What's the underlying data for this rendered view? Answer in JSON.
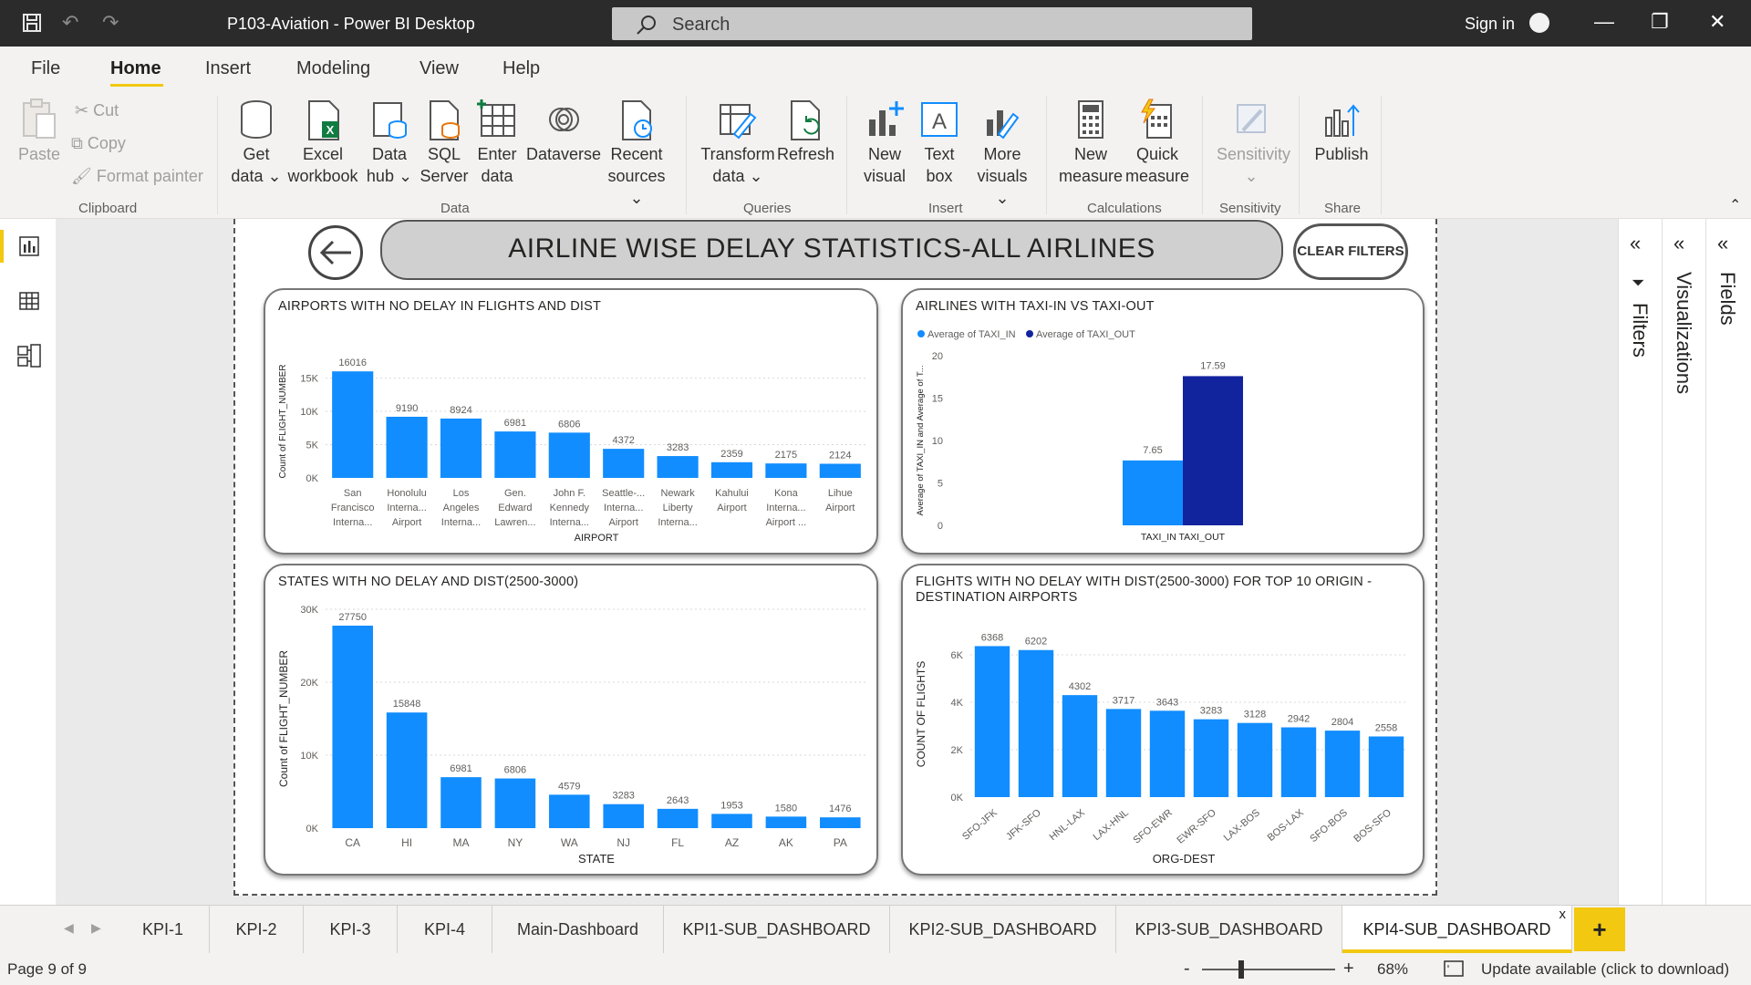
{
  "window": {
    "title": "P103-Aviation - Power BI Desktop",
    "search_placeholder": "Search",
    "signin": "Sign in"
  },
  "menu": [
    "File",
    "Home",
    "Insert",
    "Modeling",
    "View",
    "Help"
  ],
  "ribbon": {
    "clipboard": {
      "paste": "Paste",
      "cut": "Cut",
      "copy": "Copy",
      "format_painter": "Format painter",
      "group": "Clipboard"
    },
    "data": {
      "get_data": [
        "Get",
        "data"
      ],
      "excel": [
        "Excel",
        "workbook"
      ],
      "data_hub": [
        "Data",
        "hub"
      ],
      "sql": [
        "SQL",
        "Server"
      ],
      "enter": [
        "Enter",
        "data"
      ],
      "dataverse": "Dataverse",
      "recent": [
        "Recent",
        "sources"
      ],
      "group": "Data"
    },
    "queries": {
      "transform": [
        "Transform",
        "data"
      ],
      "refresh": "Refresh",
      "group": "Queries"
    },
    "insert": {
      "new_visual": [
        "New",
        "visual"
      ],
      "text_box": [
        "Text",
        "box"
      ],
      "more_visuals": [
        "More",
        "visuals"
      ],
      "group": "Insert"
    },
    "calculations": {
      "new_measure": [
        "New",
        "measure"
      ],
      "quick_measure": [
        "Quick",
        "measure"
      ],
      "group": "Calculations"
    },
    "sensitivity": {
      "label": "Sensitivity",
      "group": "Sensitivity"
    },
    "share": {
      "publish": "Publish",
      "group": "Share"
    }
  },
  "report": {
    "title": "AIRLINE WISE DELAY STATISTICS-ALL AIRLINES",
    "clear_filters": "CLEAR FILTERS"
  },
  "panes": {
    "filters": "Filters",
    "visualizations": "Visualizations",
    "fields": "Fields"
  },
  "tabs": [
    "KPI-1",
    "KPI-2",
    "KPI-3",
    "KPI-4",
    "Main-Dashboard",
    "KPI1-SUB_DASHBOARD",
    "KPI2-SUB_DASHBOARD",
    "KPI3-SUB_DASHBOARD",
    "KPI4-SUB_DASHBOARD"
  ],
  "tab_close": "x",
  "tab_add": "+",
  "status": {
    "page": "Page 9 of 9",
    "zoom_minus": "-",
    "zoom_plus": "+",
    "zoom": "68%",
    "update": "Update available (click to download)"
  },
  "colors": {
    "bar": "#118dff",
    "bar_dark": "#12239e",
    "accent": "#f2c811"
  },
  "chart_data": [
    {
      "type": "bar",
      "title": "AIRPORTS WITH NO DELAY IN FLIGHTS AND DIST",
      "xlabel": "AIRPORT",
      "ylabel": "Count of FLIGHT_NUMBER",
      "ylim": [
        0,
        17000
      ],
      "yticks": [
        "0K",
        "5K",
        "10K",
        "15K"
      ],
      "ytick_values": [
        0,
        5000,
        10000,
        15000
      ],
      "categories": [
        [
          "San",
          "Francisco",
          "Interna..."
        ],
        [
          "Honolulu",
          "Interna...",
          "Airport"
        ],
        [
          "Los",
          "Angeles",
          "Interna..."
        ],
        [
          "Gen.",
          "Edward",
          "Lawren..."
        ],
        [
          "John F.",
          "Kennedy",
          "Interna..."
        ],
        [
          "Seattle-...",
          "Interna...",
          "Airport"
        ],
        [
          "Newark",
          "Liberty",
          "Interna..."
        ],
        [
          "Kahului",
          "Airport"
        ],
        [
          "Kona",
          "Interna...",
          "Airport ..."
        ],
        [
          "Lihue",
          "Airport"
        ]
      ],
      "values": [
        16016,
        9190,
        8924,
        6981,
        6806,
        4372,
        3283,
        2359,
        2175,
        2124
      ]
    },
    {
      "type": "bar",
      "title": "AIRLINES WITH TAXI-IN VS TAXI-OUT",
      "xlabel": "TAXI_IN TAXI_OUT",
      "ylabel": "Average of TAXI_IN and Average of T...",
      "ylim": [
        0,
        20
      ],
      "yticks": [
        "0",
        "5",
        "10",
        "15",
        "20"
      ],
      "ytick_values": [
        0,
        5,
        10,
        15,
        20
      ],
      "series": [
        {
          "name": "Average of TAXI_IN",
          "values": [
            7.65
          ]
        },
        {
          "name": "Average of TAXI_OUT",
          "values": [
            17.59
          ]
        }
      ],
      "legend": "top-left"
    },
    {
      "type": "bar",
      "title": "STATES WITH NO DELAY AND DIST(2500-3000)",
      "xlabel": "STATE",
      "ylabel": "Count of FLIGHT_NUMBER",
      "ylim": [
        0,
        30000
      ],
      "yticks": [
        "0K",
        "10K",
        "20K",
        "30K"
      ],
      "ytick_values": [
        0,
        10000,
        20000,
        30000
      ],
      "categories": [
        "CA",
        "HI",
        "MA",
        "NY",
        "WA",
        "NJ",
        "FL",
        "AZ",
        "AK",
        "PA"
      ],
      "values": [
        27750,
        15848,
        6981,
        6806,
        4579,
        3283,
        2643,
        1953,
        1580,
        1476
      ]
    },
    {
      "type": "bar",
      "title": "FLIGHTS WITH NO DELAY WITH DIST(2500-3000) FOR TOP 10 ORIGIN - DESTINATION AIRPORTS",
      "xlabel": "ORG-DEST",
      "ylabel": "COUNT OF FLIGHTS",
      "ylim": [
        0,
        7000
      ],
      "yticks": [
        "0K",
        "2K",
        "4K",
        "6K"
      ],
      "ytick_values": [
        0,
        2000,
        4000,
        6000
      ],
      "categories": [
        "SFO-JFK",
        "JFK-SFO",
        "HNL-LAX",
        "LAX-HNL",
        "SFO-EWR",
        "EWR-SFO",
        "LAX-BOS",
        "BOS-LAX",
        "SFO-BOS",
        "BOS-SFO"
      ],
      "values": [
        6368,
        6202,
        4302,
        3717,
        3643,
        3283,
        3128,
        2942,
        2804,
        2558
      ]
    }
  ]
}
